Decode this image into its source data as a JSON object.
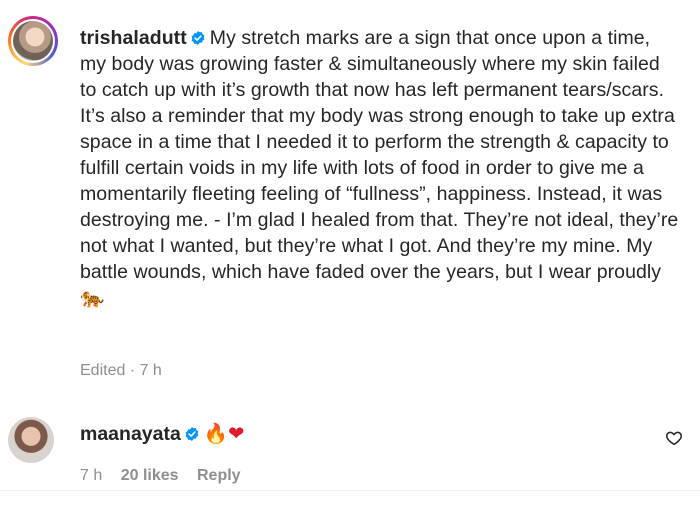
{
  "caption": {
    "username": "trishaladutt",
    "verified": true,
    "text": "My stretch marks are a sign that once upon a time, my body was growing faster & simultaneously where my skin failed to catch up with it’s growth that now has left permanent tears/scars. It’s also a reminder that my body was strong enough to take up extra space in a time that I needed it to perform the strength & capacity to fulfill certain voids in my life with lots of food in order to give me a momentarily fleeting feeling of “fullness”, happiness. Instead, it was destroying me. - I’m glad I healed from that. They’re not ideal, they’re not what I wanted, but they’re what I got. And they’re my mine. My battle wounds, which have faded over the years, but I wear proudly",
    "emoji": "🐅",
    "meta": "Edited · 7 h"
  },
  "comment": {
    "username": "maanayata",
    "verified": true,
    "emoji_fire": "🔥",
    "emoji_heart": "❤",
    "time": "7 h",
    "likes": "20 likes",
    "reply": "Reply"
  },
  "colors": {
    "text": "#262626",
    "muted": "#8e8e8e",
    "verified_blue": "#0095f6"
  }
}
